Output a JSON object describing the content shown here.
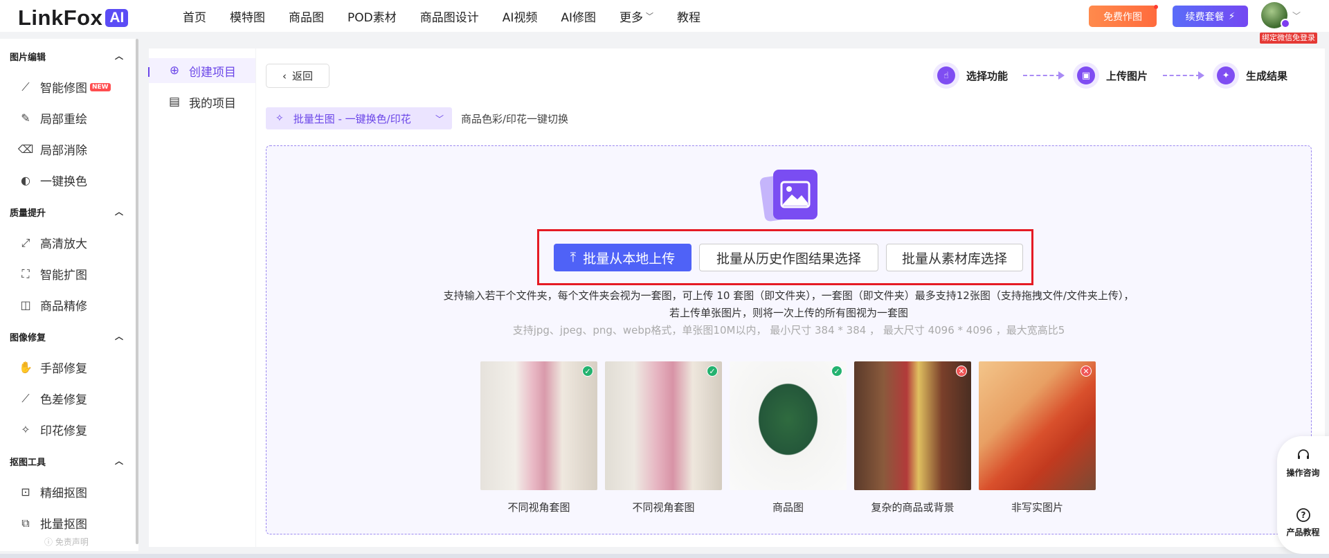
{
  "brand": {
    "name": "LinkFox",
    "ai_tag": "AI"
  },
  "nav": {
    "items": [
      "首页",
      "模特图",
      "商品图",
      "POD素材",
      "商品图设计",
      "AI视频",
      "AI修图",
      "更多",
      "教程"
    ]
  },
  "header": {
    "free_btn": "免费作图",
    "renew_btn": "续费套餐",
    "renew_icon": "⚡",
    "wechat_tag": "绑定微信免登录"
  },
  "sidebar": {
    "sections": [
      {
        "title": "图片编辑",
        "items": [
          "智能修图",
          "局部重绘",
          "局部消除",
          "一键换色"
        ]
      },
      {
        "title": "质量提升",
        "items": [
          "高清放大",
          "智能扩图",
          "商品精修"
        ]
      },
      {
        "title": "图像修复",
        "items": [
          "手部修复",
          "色差修复",
          "印花修复"
        ]
      },
      {
        "title": "抠图工具",
        "items": [
          "精细抠图",
          "批量抠图"
        ]
      }
    ],
    "new_badge": "NEW",
    "disclaimer": "免责声明"
  },
  "projects": {
    "create": "创建项目",
    "mine": "我的项目"
  },
  "main": {
    "back": "返回",
    "steps": [
      "选择功能",
      "上传图片",
      "生成结果"
    ],
    "function_select": "批量生图 - 一键换色/印花",
    "function_desc": "商品色彩/印花一键切换",
    "upload_local": "批量从本地上传",
    "upload_history": "批量从历史作图结果选择",
    "upload_library": "批量从素材库选择",
    "hint_line1": "支持输入若干个文件夹，每个文件夹会视为一套图，可上传 10 套图（即文件夹），一套图（即文件夹）最多支持12张图（支持拖拽文件/文件夹上传），",
    "hint_line2": "若上传单张图片，则将一次上传的所有图视为一套图",
    "hint_line3": "支持jpg、jpeg、png、webp格式，单张图10M以内， 最小尺寸 384 * 384 ， 最大尺寸 4096 * 4096 ，最大宽高比5",
    "samples": [
      {
        "label": "不同视角套图",
        "status": "ok"
      },
      {
        "label": "不同视角套图",
        "status": "ok"
      },
      {
        "label": "商品图",
        "status": "ok"
      },
      {
        "label": "复杂的商品或背景",
        "status": "bad"
      },
      {
        "label": "非写实图片",
        "status": "bad"
      }
    ]
  },
  "float_help": {
    "consult": "操作咨询",
    "tutorial": "产品教程"
  },
  "colors": {
    "accent": "#6b46e8",
    "primary_btn": "#4f62f7",
    "highlight": "#e51b24"
  }
}
